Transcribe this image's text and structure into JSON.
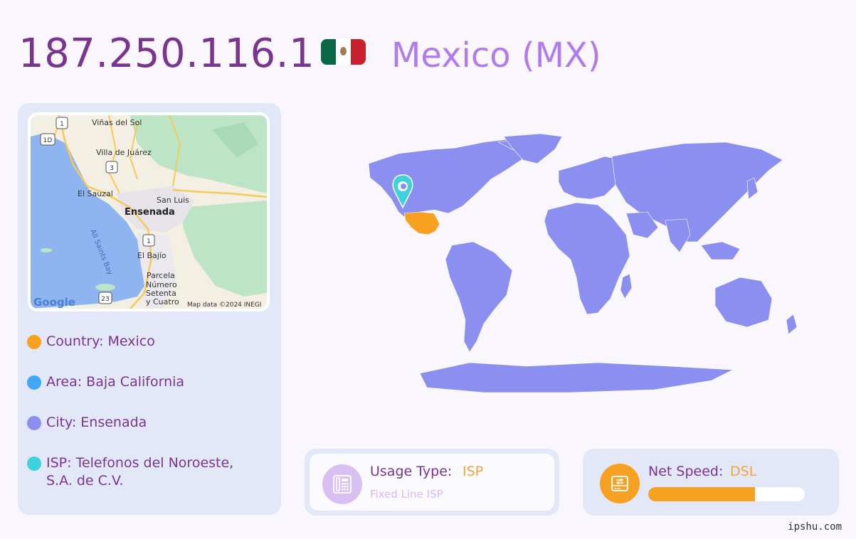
{
  "header": {
    "ip": "187.250.116.1",
    "country_title": "Mexico (MX)",
    "flag_icon": "mexico-flag-icon"
  },
  "mini_map": {
    "labels": {
      "vinas": "Viñas del Sol",
      "villa": "Villa de Juárez",
      "sauzal": "El Sauzal",
      "sanluis": "San Luis",
      "ensenada": "Ensenada",
      "bay": "All Saints Bay",
      "bajio": "El Bajío",
      "parcela": "Parcela",
      "numero": "Número",
      "setenta": "Setenta",
      "ycuatro": "y Cuatro",
      "google": "Google",
      "attribution": "Map data ©2024 INEGI"
    },
    "shields": {
      "s1a": "1",
      "s1b": "1",
      "s1d": "1D",
      "s3": "3",
      "s23": "23"
    }
  },
  "info": {
    "country": "Country: Mexico",
    "area": "Area: Baja California",
    "city": "City: Ensenada",
    "isp": "ISP: Telefonos del Noroeste, S.A. de C.V."
  },
  "colors": {
    "country_dot": "#f7a123",
    "area_dot": "#3fa7f5",
    "city_dot": "#8a8ff0",
    "isp_dot": "#3ed3dc",
    "map_land": "#8a8ff0",
    "map_highlight": "#f7a123",
    "pin": "#3ed3dc"
  },
  "usage": {
    "label": "Usage Type:",
    "value": "ISP",
    "sub": "Fixed Line ISP",
    "icon": "phone-icon"
  },
  "speed": {
    "label": "Net Speed:",
    "value": "DSL",
    "level": 0.68,
    "icon": "network-speed-icon"
  },
  "footer": {
    "site": "ipshu.com"
  }
}
